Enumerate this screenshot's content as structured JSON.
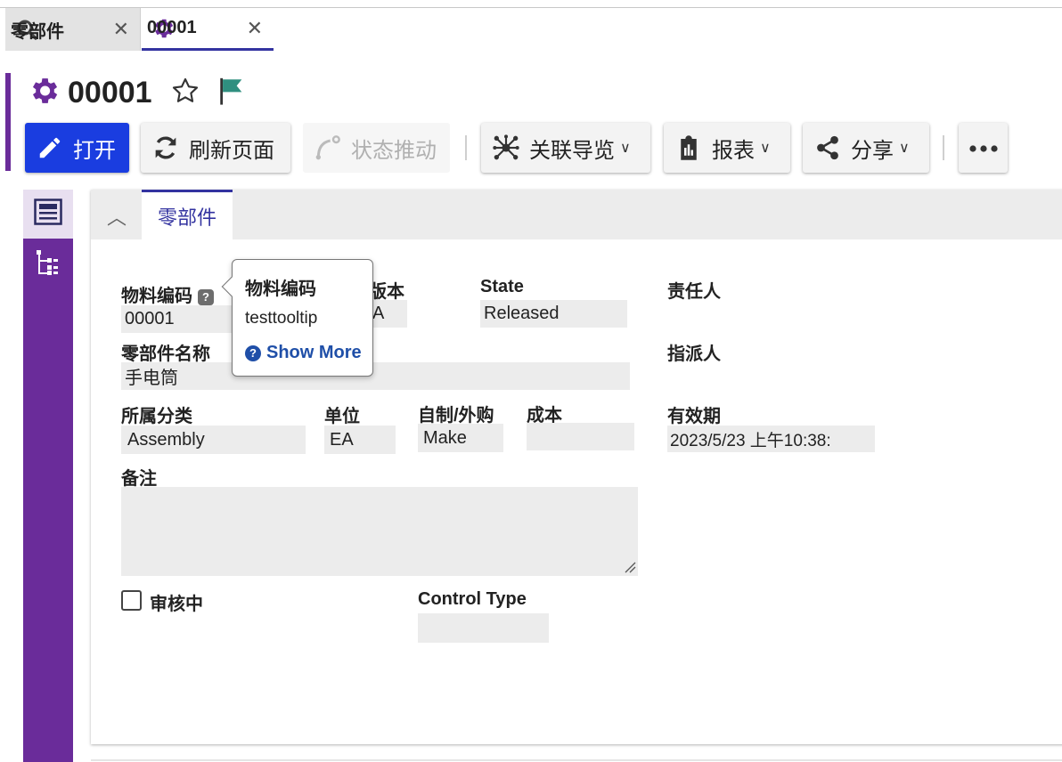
{
  "tabs": [
    {
      "label": "零部件",
      "icon": "search-icon"
    },
    {
      "label": "00001",
      "icon": "gear-icon"
    }
  ],
  "header": {
    "title": "00001"
  },
  "toolbar": {
    "open_label": "打开",
    "refresh_label": "刷新页面",
    "state_label": "状态推动",
    "nav_label": "关联导览",
    "report_label": "报表",
    "share_label": "分享"
  },
  "section": {
    "tab_label": "零部件"
  },
  "form": {
    "material_code": {
      "label": "物料编码",
      "value": "00001"
    },
    "version": {
      "label": "版本",
      "value": "A"
    },
    "state": {
      "label": "State",
      "value": "Released"
    },
    "owner": {
      "label": "责任人",
      "value": ""
    },
    "part_name": {
      "label": "零部件名称",
      "value": "手电筒"
    },
    "assignee": {
      "label": "指派人",
      "value": ""
    },
    "category": {
      "label": "所属分类",
      "value": "Assembly"
    },
    "unit": {
      "label": "单位",
      "value": "EA"
    },
    "make_buy": {
      "label": "自制/外购",
      "value": "Make"
    },
    "cost": {
      "label": "成本",
      "value": ""
    },
    "effective": {
      "label": "有效期",
      "value": "2023/5/23 上午10:38:"
    },
    "notes": {
      "label": "备注",
      "value": ""
    },
    "in_review": {
      "label": "审核中",
      "checked": false
    },
    "control_type": {
      "label": "Control Type",
      "value": ""
    }
  },
  "tooltip": {
    "title": "物料编码",
    "text": "testtooltip",
    "link": "Show More"
  },
  "colors": {
    "accent": "#6a2c9a",
    "primary": "#1a3de0",
    "tab_active": "#3333a0",
    "flag": "#2f8f7f"
  }
}
